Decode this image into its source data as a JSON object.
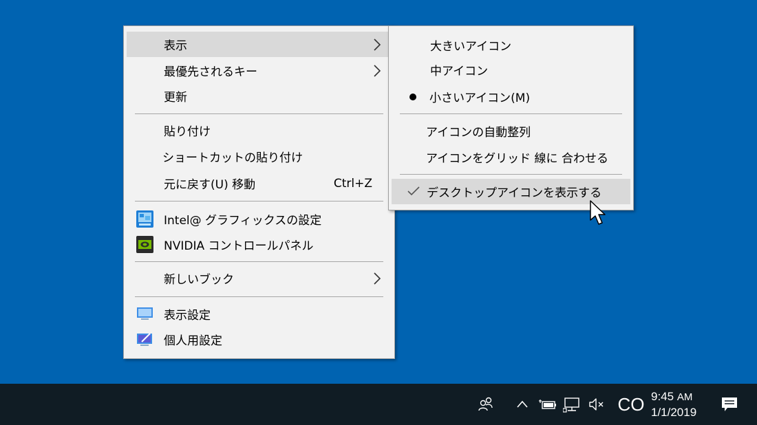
{
  "main_menu": {
    "view": "表示",
    "priority_keys": "最優先されるキー",
    "refresh": "更新",
    "paste": "貼り付け",
    "paste_shortcut": "ショートカットの貼り付け",
    "undo": "元に戻す(U) 移動",
    "undo_shortcut": "Ctrl+Z",
    "intel": "Intel@ グラフィックスの設定",
    "nvidia": "NVIDIA コントロールパネル",
    "new_book": "新しいブック",
    "display_settings": "表示設定",
    "personalize": "個人用設定"
  },
  "view_submenu": {
    "large_icons": "大きいアイコン",
    "medium_icons": "中アイコン",
    "small_icons": "小さいアイコン(M)",
    "auto_arrange": "アイコンの自動整列",
    "align_grid": "アイコンをグリッド 線に 合わせる",
    "show_desktop_icons": "デスクトップアイコンを表示する"
  },
  "taskbar": {
    "ime_indicator": "CO",
    "time": "9:45",
    "ampm": "AM",
    "date": "1/1/2019"
  },
  "icons": {
    "people": "people-icon",
    "chevron_up": "chevron-up-icon",
    "battery": "battery-icon",
    "network": "network-icon",
    "volume_muted": "volume-muted-icon",
    "notification": "notification-icon"
  },
  "colors": {
    "desktop": "#0063b1",
    "taskbar": "#101c24",
    "menu_bg": "#f2f2f2",
    "highlight": "#d9d9d9"
  }
}
